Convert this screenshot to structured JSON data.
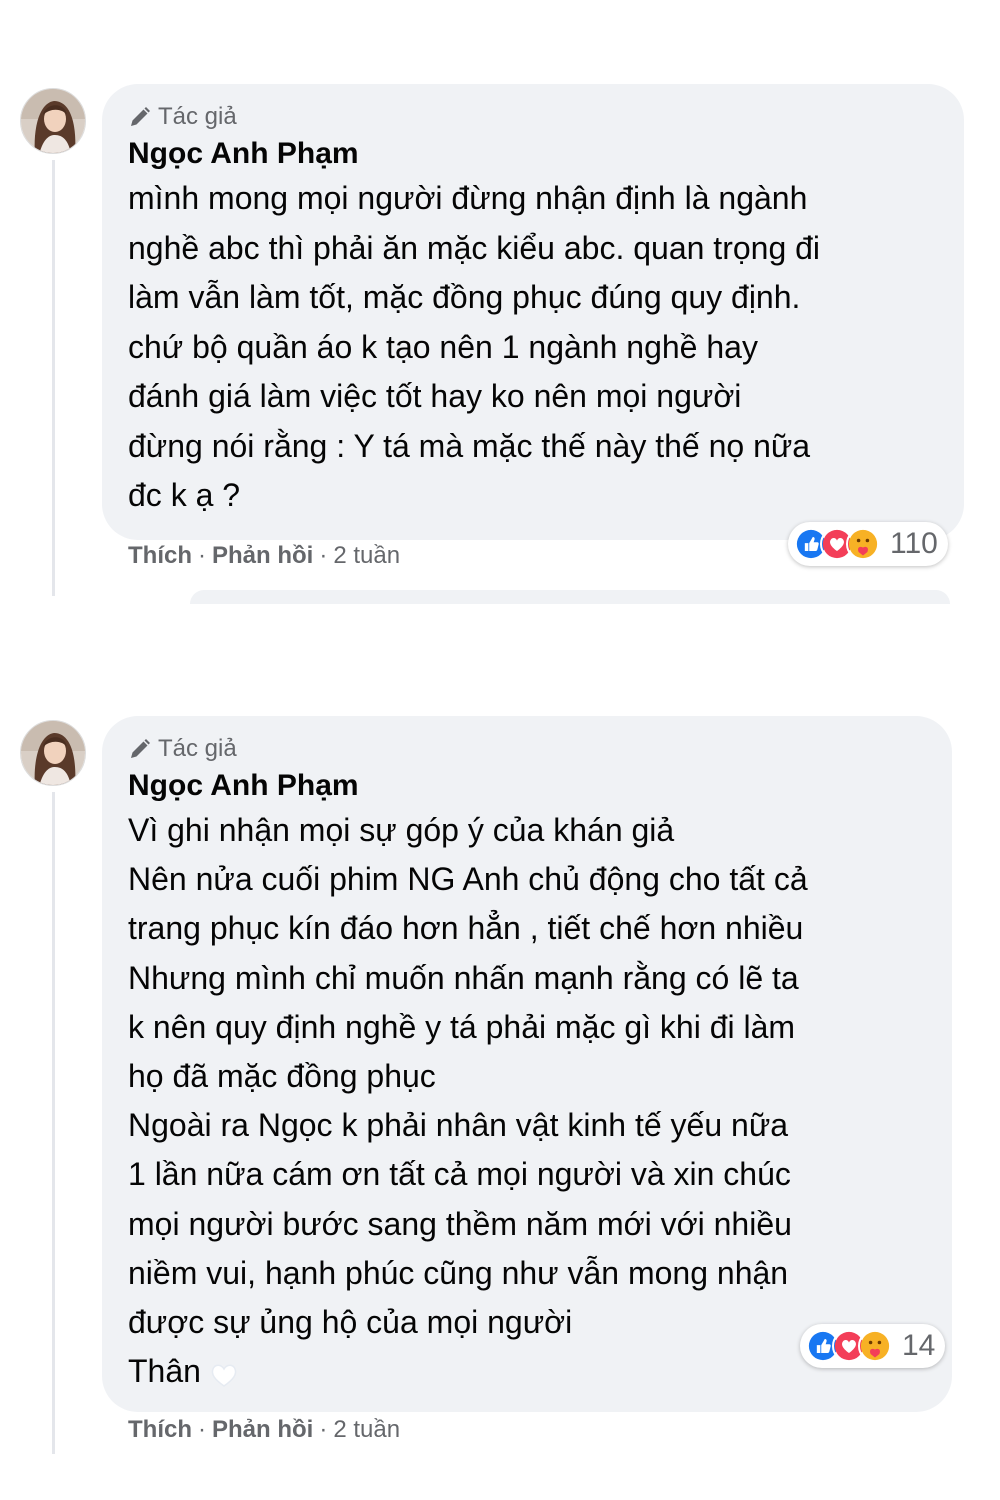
{
  "comments": [
    {
      "badge": "Tác giả",
      "author": "Ngọc Anh Phạm",
      "body": "mình mong mọi người đừng nhận định là ngành\nnghề abc thì phải ăn mặc kiểu abc. quan trọng đi\nlàm vẫn làm tốt, mặc đồng phục đúng quy định.\nchứ bộ quần áo k tạo nên 1 ngành nghề hay\nđánh giá làm việc tốt hay ko nên mọi người\nđừng nói rằng : Y tá mà mặc thế này thế nọ nữa\nđc k ạ ?",
      "reaction_count": "110",
      "like_label": "Thích",
      "reply_label": "Phản hồi",
      "time": "2 tuần"
    },
    {
      "badge": "Tác giả",
      "author": "Ngọc Anh Phạm",
      "body": "Vì ghi nhận mọi sự góp ý của khán giả\nNên nửa cuối phim NG Anh chủ động cho tất cả\ntrang phục kín đáo hơn hẳn , tiết chế hơn nhiều\nNhưng mình chỉ muốn nhấn mạnh rằng có lẽ ta\nk nên quy định nghề y tá phải mặc gì khi đi làm\nhọ đã mặc đồng phục\nNgoài ra Ngọc k phải nhân vật kinh tế yếu nữa\n1 lần nữa cám ơn tất cả mọi người và xin chúc\nmọi người bước sang thềm năm mới với nhiều\nniềm vui, hạnh phúc cũng như vẫn mong nhận\nđược sự ủng hộ của mọi người\nThân",
      "reaction_count": "14",
      "like_label": "Thích",
      "reply_label": "Phản hồi",
      "time": "2 tuần"
    }
  ],
  "separator": "·",
  "icons": {
    "badge": "pencil-icon",
    "reactions": [
      "like-reaction-icon",
      "love-reaction-icon",
      "care-reaction-icon"
    ],
    "inline_emoji": "white-heart-emoji"
  },
  "colors": {
    "bubble": "#f0f2f5",
    "secondary_text": "#65676b",
    "like_blue": "#1877f2",
    "love_red": "#f33e58",
    "care_yellow": "#f7b125"
  }
}
